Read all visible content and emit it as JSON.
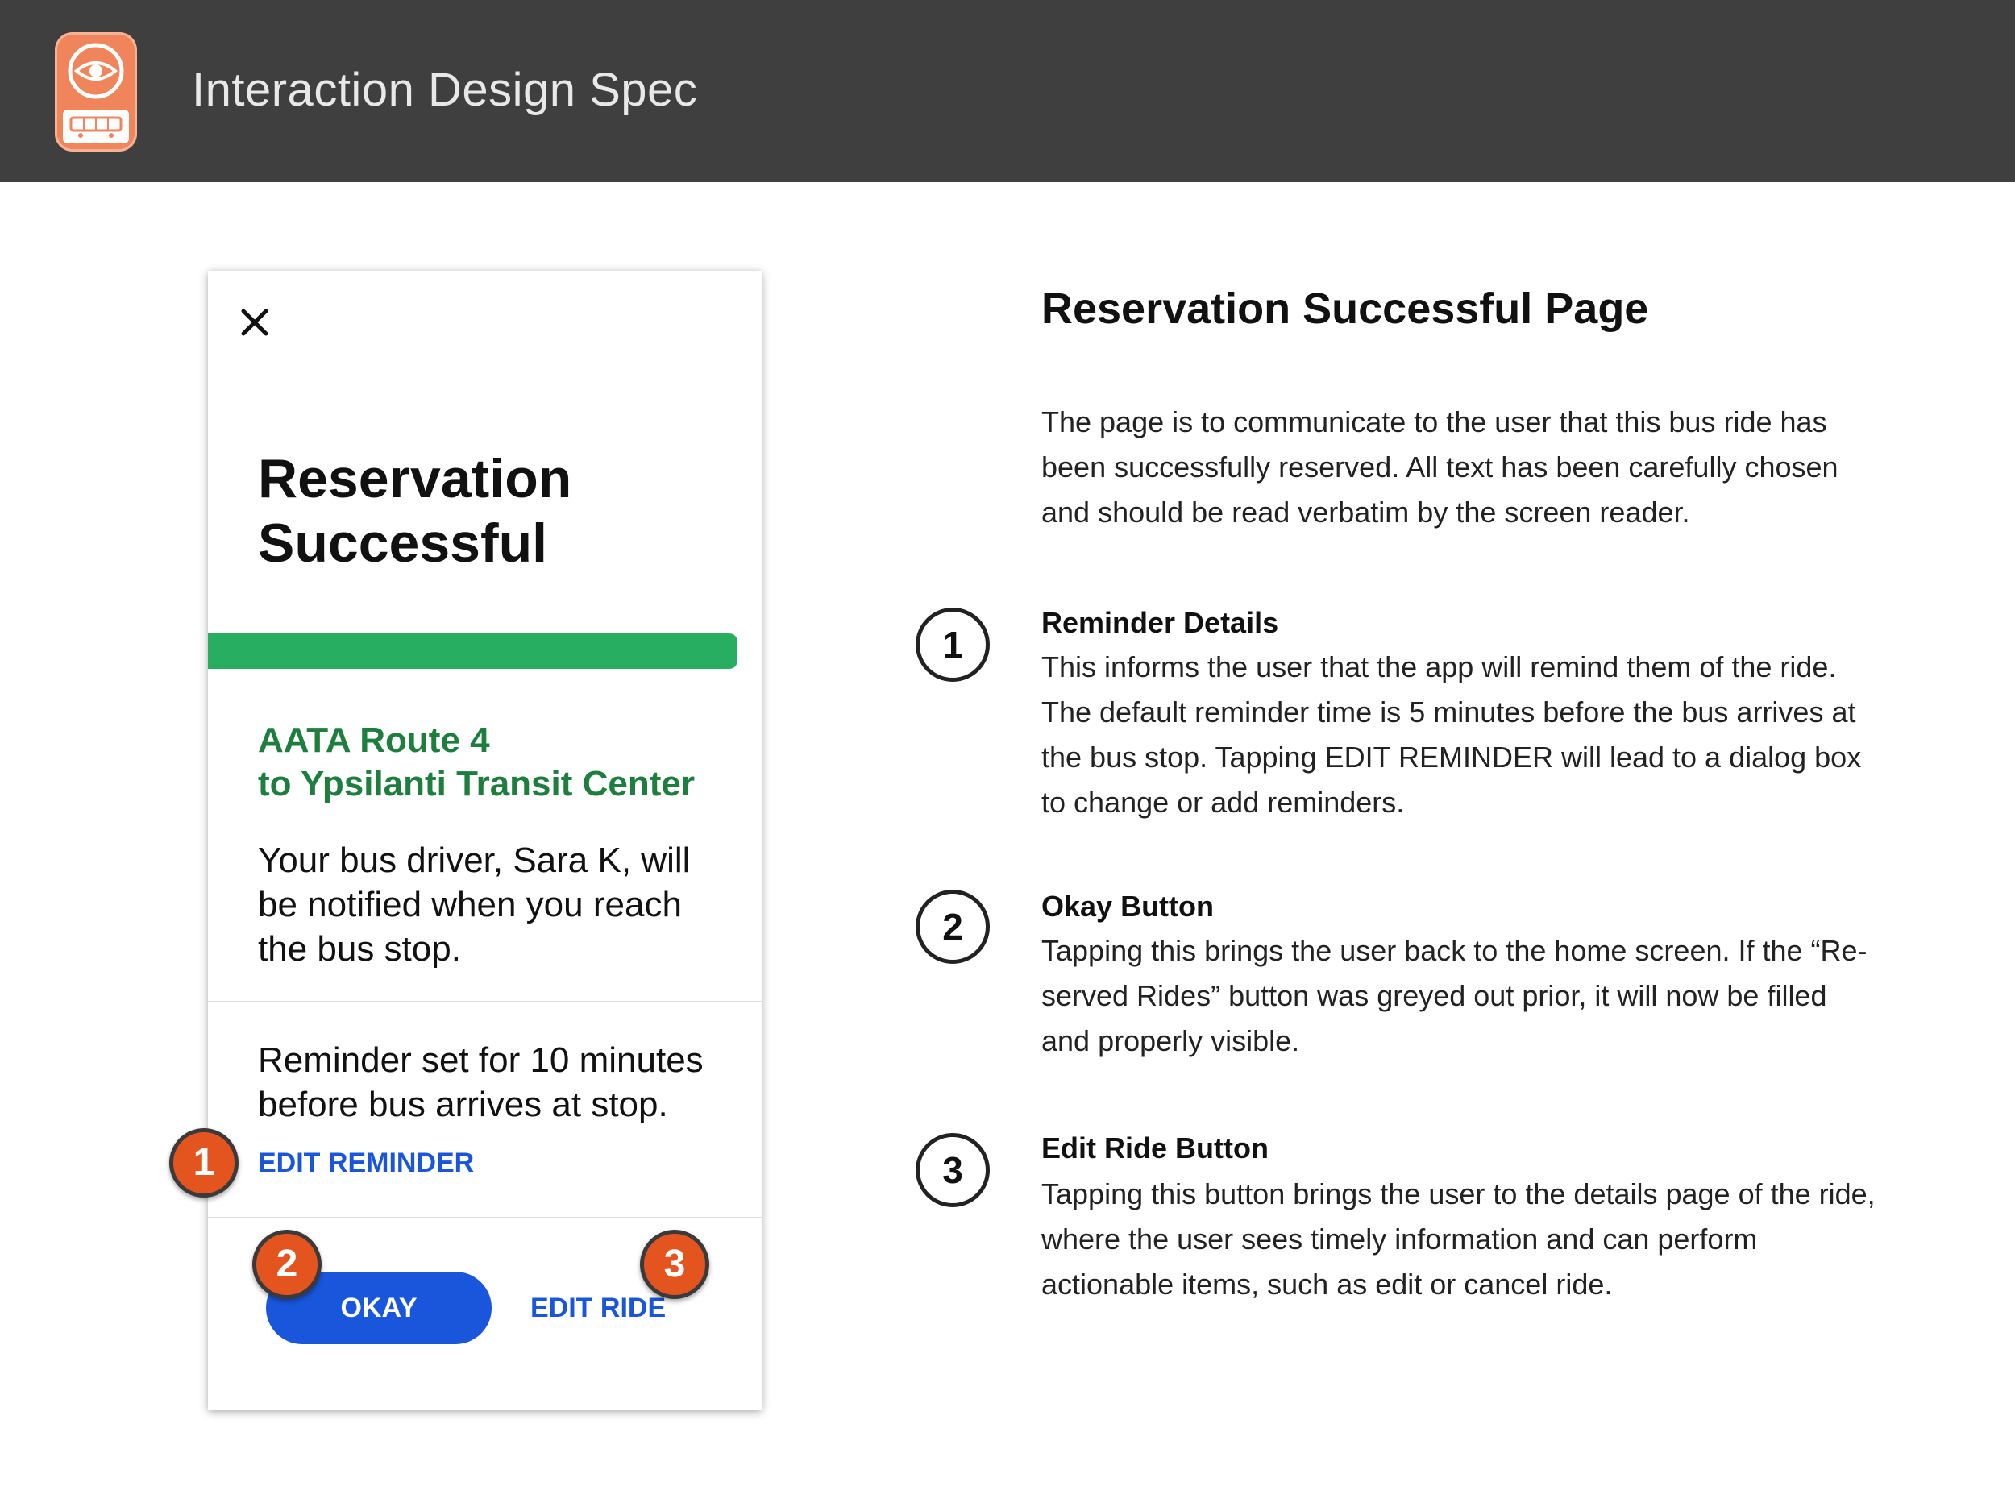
{
  "header": {
    "title": "Interaction Design Spec",
    "logo_icon": "eye-bus-logo-icon"
  },
  "phone": {
    "title": "Reservation Successful",
    "progress_fraction": 1.0,
    "route_name": "AATA Route 4",
    "route_destination": "to Ypsilanti Transit Center",
    "driver_text": "Your bus driver, Sara K, will be notified when you reach the bus stop.",
    "reminder_text": "Reminder set for 10 minutes before bus arrives at  stop.",
    "edit_reminder_label": "EDIT REMINDER",
    "okay_label": "OKAY",
    "edit_ride_label": "EDIT RIDE"
  },
  "markers": [
    "1",
    "2",
    "3"
  ],
  "spec": {
    "title": "Reservation Successful Page",
    "intro": "The page is to communicate to the user that this bus ride has been successfully reserved. All text has been carefully chosen and should be read verbatim by the screen reader.",
    "items": [
      {
        "number": "1",
        "title": "Reminder Details",
        "description": "This informs the user that the app will remind them of the ride. The default reminder time is 5 minutes before the bus arrives at the bus stop. Tapping EDIT REMINDER will lead to a dialog box to change or add reminders."
      },
      {
        "number": "2",
        "title": "Okay Button",
        "description": "Tapping this brings the user back to the home screen. If the “Re-served Rides” button was greyed out prior, it will now be filled and properly visible."
      },
      {
        "number": "3",
        "title": "Edit Ride Button",
        "description": "Tapping this button brings the user to the details page of the ride, where the user sees timely information and can perform actionable items, such as edit or cancel ride."
      }
    ]
  },
  "colors": {
    "header_bg": "#3f3f3f",
    "logo": "#f0845a",
    "progress": "#27ae60",
    "route_text": "#1e7e3e",
    "primary_blue": "#1a56db",
    "marker_orange": "#e4541f"
  }
}
